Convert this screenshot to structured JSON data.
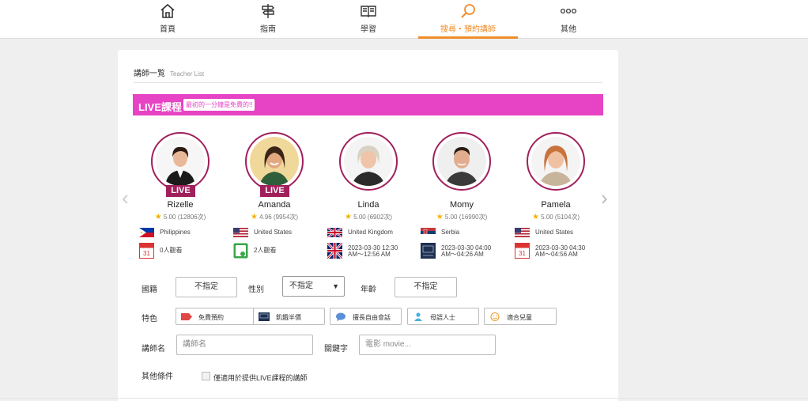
{
  "nav": {
    "items": [
      {
        "label": "首頁",
        "icon": "home-icon"
      },
      {
        "label": "指南",
        "icon": "signpost-icon"
      },
      {
        "label": "學習",
        "icon": "book-icon"
      },
      {
        "label": "搜尋・預約講師",
        "icon": "search-icon",
        "active": true
      },
      {
        "label": "其他",
        "icon": "more-icon"
      }
    ],
    "active_color": "#f08c2a"
  },
  "list": {
    "title": "講師一覧",
    "subtitle": "Teacher List"
  },
  "live_banner": {
    "title": "LIVE課程",
    "badge": "最初的一分鐘是免費的!!",
    "color": "#e743c5"
  },
  "teachers": [
    {
      "name": "Rizelle",
      "live": "LIVE",
      "rating": "5.00 (12806次)",
      "country": "Philippines",
      "status": "0人觀看",
      "status_type": "calendar"
    },
    {
      "name": "Amanda",
      "live": "LIVE",
      "rating": "4.96 (9954次)",
      "country": "United States",
      "status": "2人觀看",
      "status_type": "watching"
    },
    {
      "name": "Linda",
      "live": "",
      "rating": "5.00 (6902次)",
      "country": "United Kingdom",
      "status_line1": "2023-03-30 12:30",
      "status_line2": "AM～12:56 AM",
      "status_type": "uk-flag"
    },
    {
      "name": "Momy",
      "live": "",
      "rating": "5.00 (16990次)",
      "country": "Serbia",
      "status_line1": "2023-03-30 04:00",
      "status_line2": "AM～04:26 AM",
      "status_type": "classroom"
    },
    {
      "name": "Pamela",
      "live": "",
      "rating": "5.00 (5104次)",
      "country": "United States",
      "status_line1": "2023-03-30 04:30",
      "status_line2": "AM～04:56 AM",
      "status_type": "calendar"
    }
  ],
  "filters": {
    "nationality_label": "國籍",
    "nationality_value": "不指定",
    "gender_label": "性別",
    "gender_value": "不指定",
    "age_label": "年齡",
    "age_value": "不指定",
    "features_label": "特色",
    "features": [
      {
        "label": "免費預約",
        "icon": "tag-icon"
      },
      {
        "label": "飢餓半價",
        "icon": "classroom-icon"
      },
      {
        "label": "擅長自由會話",
        "icon": "chat-bubble-icon"
      },
      {
        "label": "母語人士",
        "icon": "person-icon"
      },
      {
        "label": "適合兒童",
        "icon": "smiley-icon"
      }
    ],
    "teacher_name_label": "講師名",
    "teacher_name_placeholder": "講師名",
    "keyword_label": "關鍵字",
    "keyword_placeholder": "電影 movie...",
    "other_label": "其他條件",
    "live_only_label": "僅適用於提供LIVE課程的講師"
  }
}
